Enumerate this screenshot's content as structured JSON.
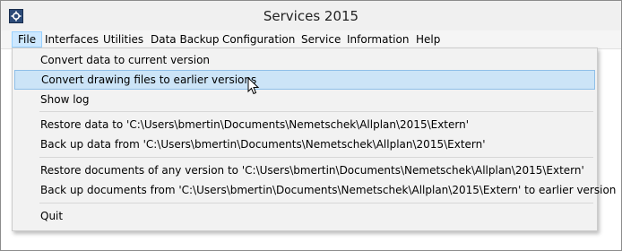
{
  "window": {
    "title": "Services 2015",
    "icon": "services-gear-icon"
  },
  "menubar": {
    "items": [
      {
        "label": "File"
      },
      {
        "label": "Interfaces"
      },
      {
        "label": "Utilities"
      },
      {
        "label": "Data Backup"
      },
      {
        "label": "Configuration"
      },
      {
        "label": "Service"
      },
      {
        "label": "Information"
      },
      {
        "label": "Help"
      }
    ]
  },
  "file_menu": {
    "items": [
      {
        "label": "Convert data to current version"
      },
      {
        "label": "Convert drawing files to earlier versions"
      },
      {
        "label": "Show log"
      },
      {
        "label": "Restore data to 'C:\\Users\\bmertin\\Documents\\Nemetschek\\Allplan\\2015\\Extern'"
      },
      {
        "label": "Back up data from 'C:\\Users\\bmertin\\Documents\\Nemetschek\\Allplan\\2015\\Extern'"
      },
      {
        "label": "Restore documents of any version to 'C:\\Users\\bmertin\\Documents\\Nemetschek\\Allplan\\2015\\Extern'"
      },
      {
        "label": "Back up documents from 'C:\\Users\\bmertin\\Documents\\Nemetschek\\Allplan\\2015\\Extern' to earlier version"
      },
      {
        "label": "Quit"
      }
    ]
  },
  "colors": {
    "menu_highlight": "#cce4f7",
    "menu_open": "#cde8ff"
  }
}
